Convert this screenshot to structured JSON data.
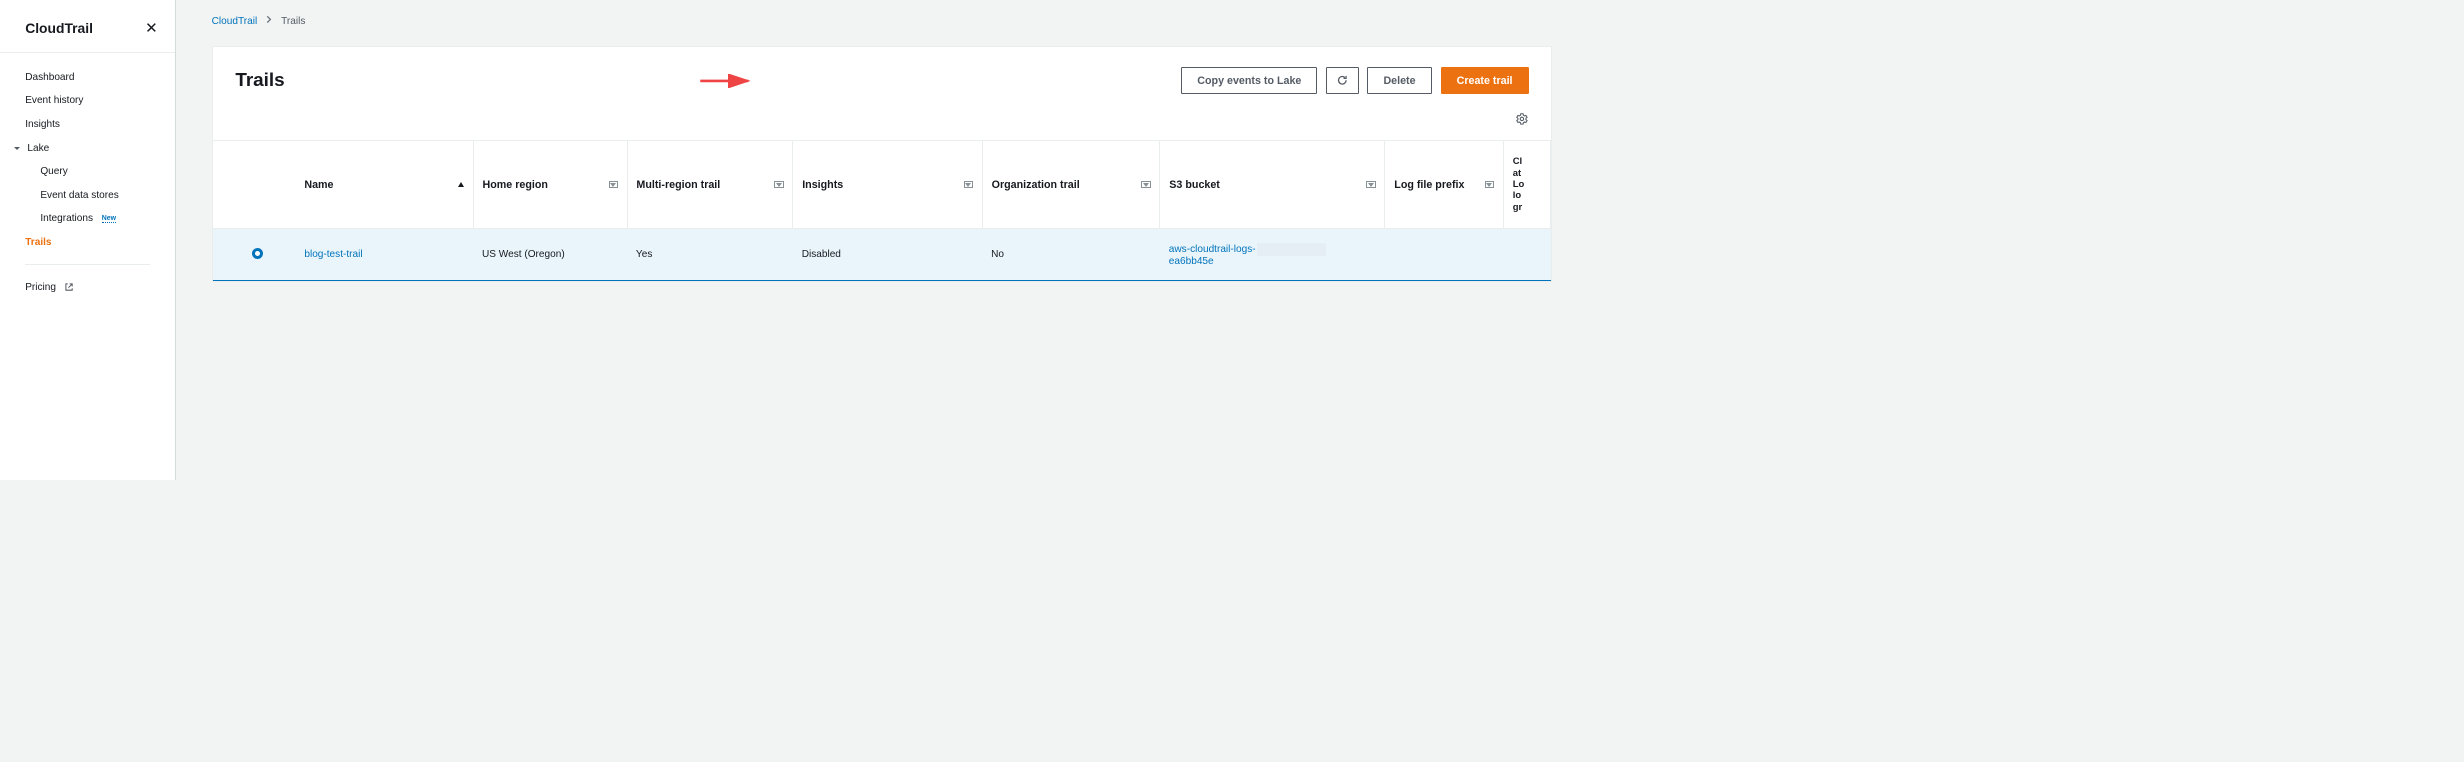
{
  "sidebar": {
    "title": "CloudTrail",
    "items": [
      {
        "label": "Dashboard"
      },
      {
        "label": "Event history"
      },
      {
        "label": "Insights"
      },
      {
        "label": "Lake",
        "expandable": true
      },
      {
        "label": "Query",
        "sub": true
      },
      {
        "label": "Event data stores",
        "sub": true
      },
      {
        "label": "Integrations",
        "sub": true,
        "badge": "New"
      },
      {
        "label": "Trails",
        "active": true
      }
    ],
    "footer": {
      "label": "Pricing"
    }
  },
  "breadcrumb": {
    "root": "CloudTrail",
    "current": "Trails"
  },
  "panel": {
    "title": "Trails",
    "actions": {
      "copy": "Copy events to Lake",
      "delete": "Delete",
      "create": "Create trail"
    }
  },
  "table": {
    "columns": {
      "name": "Name",
      "home_region": "Home region",
      "multi_region": "Multi-region trail",
      "insights": "Insights",
      "org_trail": "Organization trail",
      "s3_bucket": "S3 bucket",
      "log_prefix": "Log file prefix",
      "cwlogs": "CloudWatch Logs log group"
    },
    "rows": [
      {
        "selected": true,
        "name": "blog-test-trail",
        "home_region": "US West (Oregon)",
        "multi_region": "Yes",
        "insights": "Disabled",
        "org_trail": "No",
        "s3_bucket_prefix": "aws-cloudtrail-logs-",
        "s3_bucket_suffix": "ea6bb45e",
        "log_prefix": ""
      }
    ]
  }
}
